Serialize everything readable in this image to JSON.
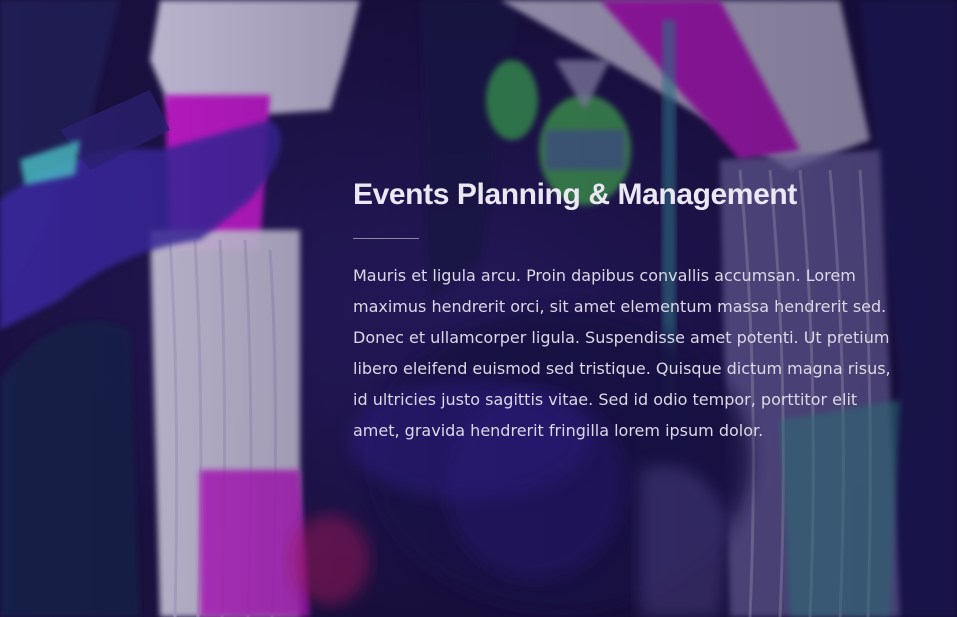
{
  "hero": {
    "title": "Events Planning & Management",
    "body": "Mauris et ligula arcu. Proin dapibus convallis accumsan. Lorem maximus hendrerit orci, sit amet elementum massa hendrerit sed. Donec et ullamcorper ligula. Suspendisse amet potenti. Ut pretium libero eleifend euismod sed tristique. Quisque dictum magna risus, id ultricies justo sagittis vitae. Sed id odio tempor, porttitor elit amet, gravida hendrerit fringilla lorem ipsum dolor."
  },
  "colors": {
    "background": "#1b1140",
    "accent_magenta": "#d21fd8",
    "accent_violet": "#6a3dd6",
    "title_text": "#ece8f3",
    "body_text": "#dcd8e6"
  }
}
